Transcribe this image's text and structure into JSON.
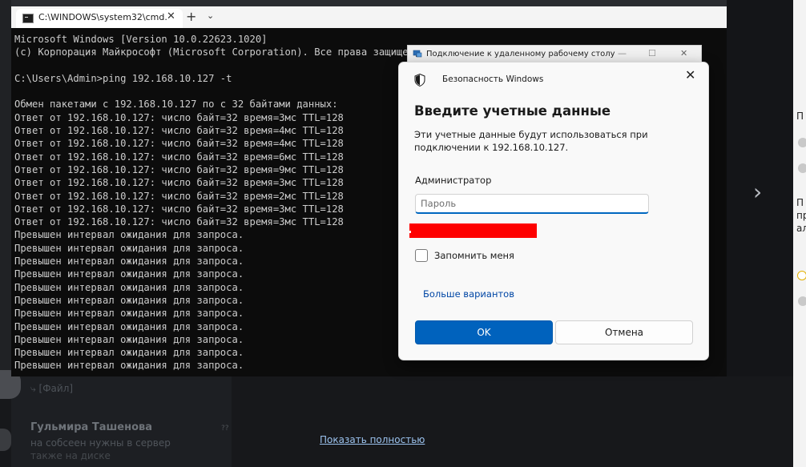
{
  "background": {
    "show_full_link": "Показать полностью",
    "file_label": "⤷ [Файл]",
    "contact_name": "Гульмира Ташенова",
    "message_snippet": "на собсеен нужны в сервер",
    "message_snippet2": "также на диске",
    "timestamp": "??",
    "right_letters": [
      "П",
      "П",
      "пр",
      "ал"
    ],
    "chevron": "›"
  },
  "terminal": {
    "tab_title": "C:\\WINDOWS\\system32\\cmd.",
    "tab_close": "✕",
    "new_tab": "+",
    "dropdown": "⌄",
    "lines": [
      "Microsoft Windows [Version 10.0.22623.1020]",
      "(c) Корпорация Майкрософт (Microsoft Corporation). Все права защищены.",
      "",
      "C:\\Users\\Admin>ping 192.168.10.127 -t",
      "",
      "Обмен пакетами с 192.168.10.127 по с 32 байтами данных:",
      "Ответ от 192.168.10.127: число байт=32 время=3мс TTL=128",
      "Ответ от 192.168.10.127: число байт=32 время=4мс TTL=128",
      "Ответ от 192.168.10.127: число байт=32 время=4мс TTL=128",
      "Ответ от 192.168.10.127: число байт=32 время=6мс TTL=128",
      "Ответ от 192.168.10.127: число байт=32 время=9мс TTL=128",
      "Ответ от 192.168.10.127: число байт=32 время=3мс TTL=128",
      "Ответ от 192.168.10.127: число байт=32 время=2мс TTL=128",
      "Ответ от 192.168.10.127: число байт=32 время=3мс TTL=128",
      "Ответ от 192.168.10.127: число байт=32 время=3мс TTL=128",
      "Превышен интервал ожидания для запроса.",
      "Превышен интервал ожидания для запроса.",
      "Превышен интервал ожидания для запроса.",
      "Превышен интервал ожидания для запроса.",
      "Превышен интервал ожидания для запроса.",
      "Превышен интервал ожидания для запроса.",
      "Превышен интервал ожидания для запроса.",
      "Превышен интервал ожидания для запроса.",
      "Превышен интервал ожидания для запроса.",
      "Превышен интервал ожидания для запроса.",
      "Превышен интервал ожидания для запроса."
    ]
  },
  "rdp_window": {
    "title": "Подключение к удаленному рабочему столу",
    "minimize": "—",
    "maximize": "☐",
    "close": "✕"
  },
  "dialog": {
    "caption": "Безопасность Windows",
    "close": "✕",
    "heading": "Введите учетные данные",
    "description": "Эти учетные данные будут использоваться при подключении к 192.168.10.127.",
    "username": "Администратор",
    "password_placeholder": "Пароль",
    "password_value": "",
    "remember_label": "Запомнить меня",
    "remember_checked": false,
    "more_options": "Больше вариантов",
    "ok_label": "OK",
    "cancel_label": "Отмена"
  },
  "colors": {
    "accent": "#0062bd",
    "redaction": "#fe0000",
    "console_bg": "#0c0c0c",
    "console_text": "#cccccc"
  }
}
